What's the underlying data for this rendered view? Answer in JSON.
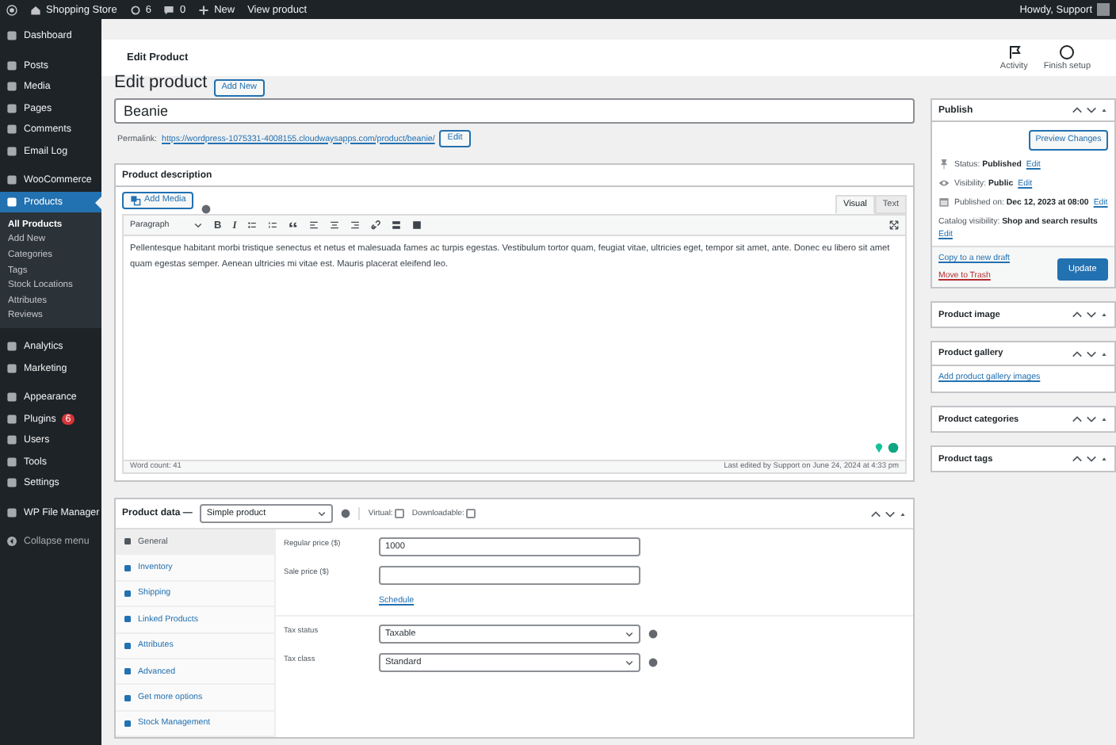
{
  "admin_bar": {
    "site": "Shopping Store",
    "updates": "6",
    "comments": "0",
    "new": "New",
    "view": "View product",
    "greeting": "Howdy, Support"
  },
  "sidebar": {
    "groups": [
      {
        "items": [
          {
            "label": "Dashboard",
            "selected": false
          }
        ]
      },
      {
        "items": [
          {
            "label": "Posts",
            "selected": false
          },
          {
            "label": "Media",
            "selected": false
          },
          {
            "label": "Pages",
            "selected": false
          },
          {
            "label": "Comments",
            "selected": false
          },
          {
            "label": "Email Log",
            "selected": false
          }
        ]
      },
      {
        "items": [
          {
            "label": "WooCommerce",
            "selected": false
          },
          {
            "label": "Products",
            "selected": true,
            "children": [
              {
                "label": "All Products",
                "selected": true
              },
              {
                "label": "Add New",
                "selected": false
              },
              {
                "label": "Categories",
                "selected": false
              },
              {
                "label": "Tags",
                "selected": false
              },
              {
                "label": "Stock Locations",
                "selected": false
              },
              {
                "label": "Attributes",
                "selected": false
              },
              {
                "label": "Reviews",
                "selected": false
              }
            ]
          }
        ]
      },
      {
        "items": [
          {
            "label": "Analytics",
            "selected": false
          },
          {
            "label": "Marketing",
            "selected": false
          }
        ]
      },
      {
        "items": [
          {
            "label": "Appearance",
            "selected": false
          },
          {
            "label": "Plugins",
            "selected": false,
            "badge": "6"
          },
          {
            "label": "Users",
            "selected": false
          },
          {
            "label": "Tools",
            "selected": false
          },
          {
            "label": "Settings",
            "selected": false
          }
        ]
      },
      {
        "items": [
          {
            "label": "WP File Manager",
            "selected": false
          }
        ]
      }
    ],
    "collapse": "Collapse menu"
  },
  "header": {
    "title": "Edit Product",
    "actions": [
      {
        "label": "Activity",
        "kind": "flag"
      },
      {
        "label": "Finish setup",
        "kind": "ring"
      }
    ]
  },
  "page": {
    "heading": "Edit product",
    "add_new": "Add New"
  },
  "title_field": {
    "value": "Beanie"
  },
  "permalink": {
    "label": "Permalink:",
    "url": "https://wordpress-1075331-4008155.cloudwaysapps.com/product/beanie/",
    "edit": "Edit"
  },
  "description": {
    "title": "Product description",
    "add_media": "Add Media",
    "tabs": [
      {
        "label": "Visual",
        "selected": true
      },
      {
        "label": "Text",
        "selected": false
      }
    ],
    "format": "Paragraph",
    "toolbar": [
      {
        "kind": "bold",
        "label": "B"
      },
      {
        "kind": "italic",
        "label": "I"
      },
      {
        "kind": "bullets"
      },
      {
        "kind": "numbers"
      },
      {
        "kind": "quote"
      },
      {
        "kind": "align-left"
      },
      {
        "kind": "align-center"
      },
      {
        "kind": "align-right"
      },
      {
        "kind": "link"
      },
      {
        "kind": "more"
      },
      {
        "kind": "kitchen"
      }
    ],
    "body": "Pellentesque habitant morbi tristique senectus et netus et malesuada fames ac turpis egestas. Vestibulum tortor quam, feugiat vitae, ultricies eget, tempor sit amet, ante. Donec eu libero sit amet quam egestas semper. Aenean ultricies mi vitae est. Mauris placerat eleifend leo.",
    "word_count": "Word count: 41",
    "last_edited": "Last edited by Support on June 24, 2024 at 4:33 pm"
  },
  "product_data": {
    "label": "Product data —",
    "type": "Simple product",
    "virtual": {
      "label": "Virtual:",
      "checked": false
    },
    "downloadable": {
      "label": "Downloadable:",
      "checked": false
    },
    "tabs": [
      {
        "label": "General",
        "selected": true
      },
      {
        "label": "Inventory",
        "selected": false
      },
      {
        "label": "Shipping",
        "selected": false
      },
      {
        "label": "Linked Products",
        "selected": false
      },
      {
        "label": "Attributes",
        "selected": false
      },
      {
        "label": "Advanced",
        "selected": false
      },
      {
        "label": "Get more options",
        "selected": false
      },
      {
        "label": "Stock Management",
        "selected": false
      }
    ],
    "pricing": [
      {
        "label": "Regular price ($)",
        "value": "1000"
      },
      {
        "label": "Sale price ($)"
      }
    ],
    "schedule": "Schedule",
    "tax": [
      {
        "label": "Tax status",
        "value": "Taxable"
      },
      {
        "label": "Tax class",
        "value": "Standard"
      }
    ]
  },
  "publish": {
    "title": "Publish",
    "preview": "Preview Changes",
    "rows": [
      {
        "kind": "pin",
        "label": "Status:",
        "value": "Published",
        "edit": "Edit"
      },
      {
        "kind": "eye",
        "label": "Visibility:",
        "value": "Public",
        "edit": "Edit"
      },
      {
        "kind": "calendar",
        "label": "Published on:",
        "value": "Dec 12, 2023 at 08:00",
        "edit": "Edit"
      }
    ],
    "catalog": {
      "label": "Catalog visibility:",
      "value": "Shop and search results",
      "edit": "Edit"
    },
    "copy": "Copy to a new draft",
    "trash": "Move to Trash",
    "update": "Update"
  },
  "side_boxes": [
    {
      "title": "Product image"
    },
    {
      "title": "Product gallery",
      "link": "Add product gallery images"
    },
    {
      "title": "Product categories"
    },
    {
      "title": "Product tags"
    }
  ]
}
